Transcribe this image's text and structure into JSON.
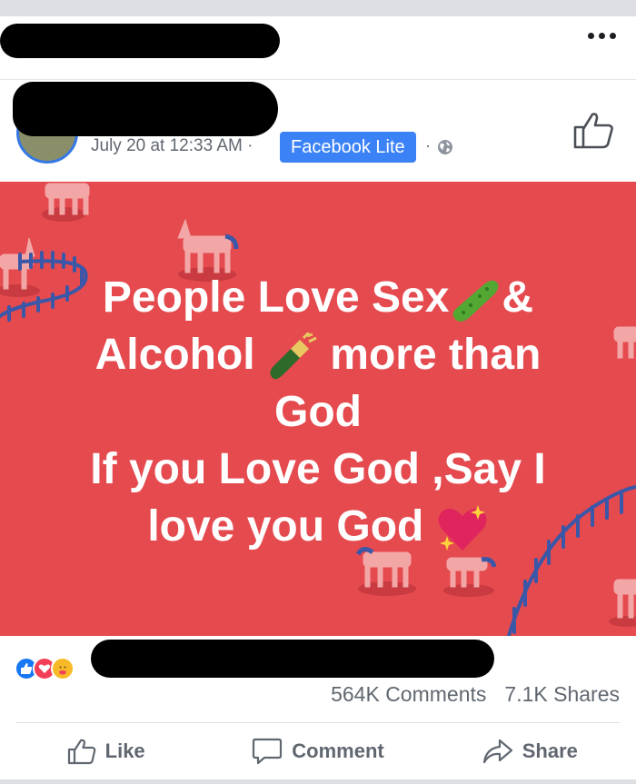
{
  "header": {
    "more_label": "More options"
  },
  "post": {
    "timestamp": "July 20 at 12:33 AM ·",
    "app_badge": "Facebook Lite",
    "privacy_separator": "·",
    "banner": {
      "background_color": "#e54a4f",
      "lines": [
        {
          "text": "People Love Sex",
          "trail": "&",
          "emoji": "cucumber"
        },
        {
          "text": "Alcohol ",
          "trail": " more than",
          "emoji": "champagne-bottle"
        },
        {
          "text": "God",
          "trail": "",
          "emoji": ""
        },
        {
          "text": "If you Love God ,Say I",
          "trail": "",
          "emoji": ""
        },
        {
          "text": "love you God ",
          "trail": "",
          "emoji": "sparkling-heart"
        }
      ]
    },
    "reactions": [
      "like",
      "love",
      "care"
    ],
    "comments_count": "564K Comments",
    "shares_count": "7.1K Shares"
  },
  "actions": {
    "like": "Like",
    "comment": "Comment",
    "share": "Share"
  },
  "colors": {
    "facebook_blue": "#1877f2",
    "badge_blue": "#3b82f6",
    "love_red": "#f33e58",
    "care_yellow": "#f7b928",
    "unicorn_pink": "#f2a7a6",
    "fence_blue": "#3a57a8"
  }
}
